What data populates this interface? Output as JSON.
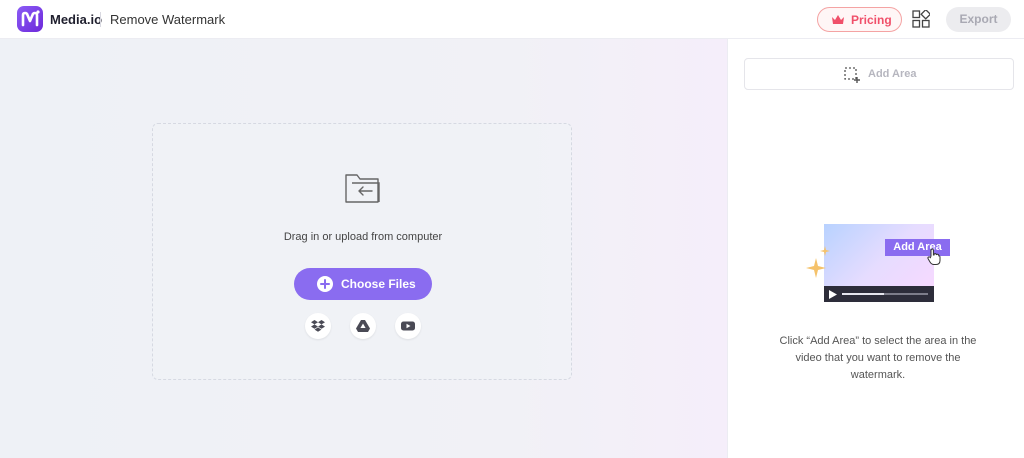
{
  "header": {
    "brand": "Media.io",
    "page_title": "Remove Watermark",
    "pricing_label": "Pricing",
    "export_label": "Export",
    "icons": {
      "logo": "media-io-logo",
      "pricing": "crown-icon",
      "apps": "apps-grid-icon"
    }
  },
  "upload": {
    "prompt": "Drag in or upload from computer",
    "choose_label": "Choose Files",
    "sources": [
      "dropbox-icon",
      "google-drive-icon",
      "youtube-icon"
    ]
  },
  "panel": {
    "add_area_label": "Add Area",
    "illustration_badge": "Add Area",
    "description": "Click “Add Area” to select the area in the video that you want to remove the watermark."
  },
  "colors": {
    "accent": "#8a6cf0",
    "pricing_text": "#f0506a",
    "disabled_text": "#a9a9b3"
  }
}
